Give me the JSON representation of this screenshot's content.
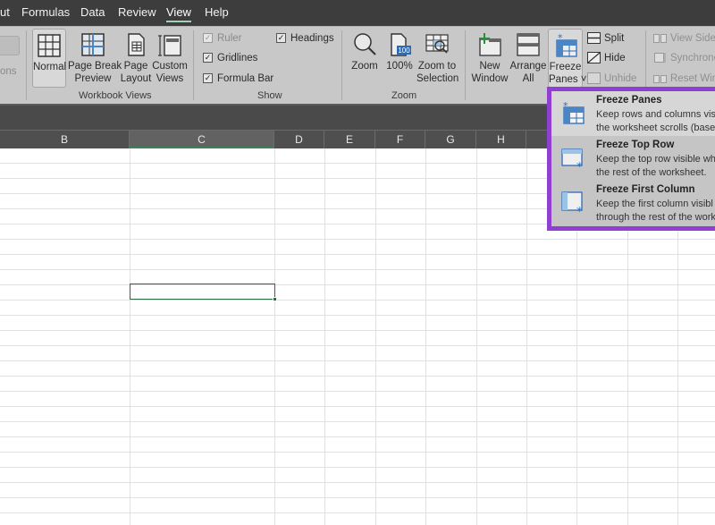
{
  "tabs": [
    {
      "label": "ut",
      "active": false
    },
    {
      "label": "Formulas",
      "active": false
    },
    {
      "label": "Data",
      "active": false
    },
    {
      "label": "Review",
      "active": false
    },
    {
      "label": "View",
      "active": true
    },
    {
      "label": "Help",
      "active": false
    }
  ],
  "ribbon": {
    "left_stub_label": "ons",
    "workbook_views": {
      "group_label": "Workbook Views",
      "normal": "Normal",
      "page_break_preview": [
        "Page Break",
        "Preview"
      ],
      "page_layout": [
        "Page",
        "Layout"
      ],
      "custom_views": [
        "Custom",
        "Views"
      ]
    },
    "show": {
      "group_label": "Show",
      "ruler": {
        "label": "Ruler",
        "checked": true,
        "disabled": true
      },
      "gridlines": {
        "label": "Gridlines",
        "checked": true
      },
      "formula_bar": {
        "label": "Formula Bar",
        "checked": true
      },
      "headings": {
        "label": "Headings",
        "checked": true
      }
    },
    "zoom": {
      "group_label": "Zoom",
      "zoom": "Zoom",
      "hundred": "100%",
      "hundred_icon_text": "100",
      "zoom_to_selection": [
        "Zoom to",
        "Selection"
      ]
    },
    "window": {
      "new_window": [
        "New",
        "Window"
      ],
      "arrange_all": [
        "Arrange",
        "All"
      ],
      "freeze_panes": [
        "Freeze",
        "Panes ˅"
      ],
      "split": "Split",
      "hide": "Hide",
      "unhide": "Unhide",
      "view_side_by_side": "View Side b",
      "synchronous": "Synchronou",
      "reset_window": "Reset Wind"
    }
  },
  "columns": [
    {
      "label": "B",
      "selected": false
    },
    {
      "label": "C",
      "selected": true
    },
    {
      "label": "D",
      "selected": false
    },
    {
      "label": "E",
      "selected": false
    },
    {
      "label": "F",
      "selected": false
    },
    {
      "label": "G",
      "selected": false
    },
    {
      "label": "H",
      "selected": false
    }
  ],
  "freeze_menu": {
    "highlight_color": "#8f3fd1",
    "items": [
      {
        "title": "Freeze Panes",
        "desc": [
          "Keep rows and columns visi",
          "the worksheet scrolls (based"
        ]
      },
      {
        "title": "Freeze Top Row",
        "desc": [
          "Keep the top row visible wh",
          "the rest of the worksheet."
        ]
      },
      {
        "title": "Freeze First Column",
        "desc": [
          "Keep the first column visibl",
          "through the rest of the work"
        ]
      }
    ]
  }
}
